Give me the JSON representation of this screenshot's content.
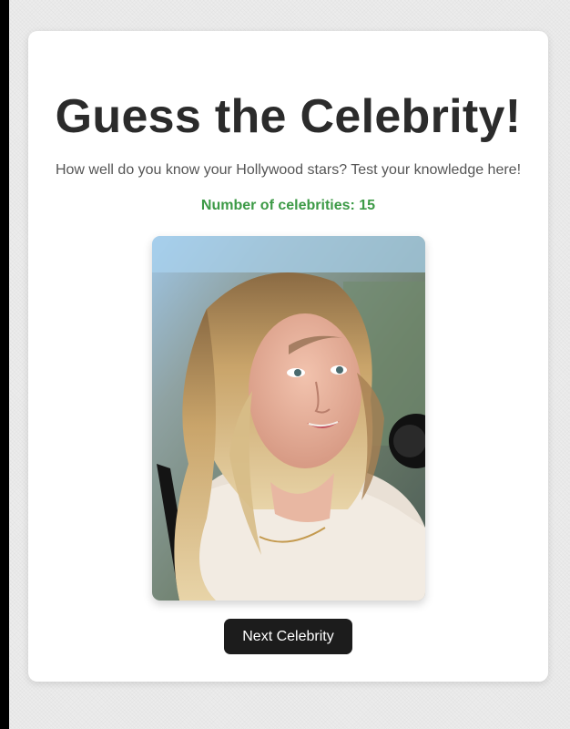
{
  "header": {
    "title": "Guess the Celebrity!",
    "subtitle": "How well do you know your Hollywood stars? Test your knowledge here!"
  },
  "stats": {
    "count_text": "Number of celebrities: 15"
  },
  "celebrity": {
    "image_icon": "celebrity-photo"
  },
  "actions": {
    "next_label": "Next Celebrity"
  },
  "colors": {
    "count_green": "#3c9a46",
    "button_bg": "#1c1c1c",
    "card_bg": "#ffffff",
    "page_bg": "#ececec"
  }
}
